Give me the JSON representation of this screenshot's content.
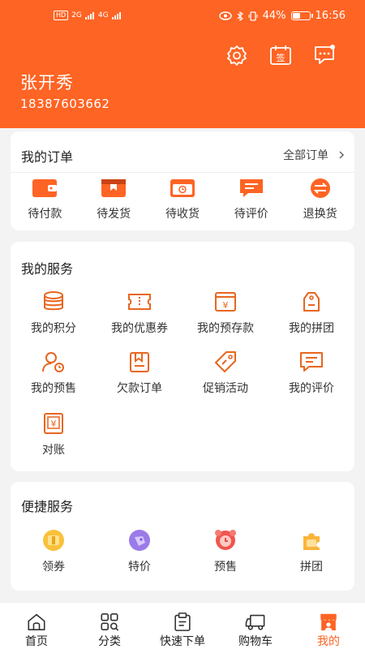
{
  "status_bar": {
    "left_indicators": [
      "HD",
      "2G",
      "4G"
    ],
    "battery_percent": "44%",
    "time": "16:56"
  },
  "header": {
    "icons": [
      "settings-icon",
      "sign-in-icon",
      "message-icon"
    ],
    "user_name": "张开秀",
    "phone": "18387603662"
  },
  "orders": {
    "title": "我的订单",
    "all_label": "全部订单",
    "items": [
      {
        "label": "待付款",
        "icon": "wallet-icon"
      },
      {
        "label": "待发货",
        "icon": "box-icon"
      },
      {
        "label": "待收货",
        "icon": "delivery-icon"
      },
      {
        "label": "待评价",
        "icon": "comment-icon"
      },
      {
        "label": "退换货",
        "icon": "exchange-icon"
      }
    ]
  },
  "services": {
    "title": "我的服务",
    "items": [
      {
        "label": "我的积分",
        "icon": "points-icon"
      },
      {
        "label": "我的优惠券",
        "icon": "coupon-icon"
      },
      {
        "label": "我的预存款",
        "icon": "deposit-icon"
      },
      {
        "label": "我的拼团",
        "icon": "group-buy-icon"
      },
      {
        "label": "我的预售",
        "icon": "presale-icon"
      },
      {
        "label": "欠款订单",
        "icon": "debt-order-icon"
      },
      {
        "label": "促销活动",
        "icon": "promotion-icon"
      },
      {
        "label": "我的评价",
        "icon": "review-icon"
      },
      {
        "label": "对账",
        "icon": "reconcile-icon"
      }
    ]
  },
  "quick": {
    "title": "便捷服务",
    "items": [
      {
        "label": "领券",
        "icon": "get-coupon-icon"
      },
      {
        "label": "特价",
        "icon": "special-price-icon"
      },
      {
        "label": "预售",
        "icon": "alarm-icon"
      },
      {
        "label": "拼团",
        "icon": "puzzle-icon"
      }
    ]
  },
  "tabbar": {
    "items": [
      {
        "label": "首页",
        "icon": "home-icon"
      },
      {
        "label": "分类",
        "icon": "category-icon"
      },
      {
        "label": "快速下单",
        "icon": "clipboard-icon"
      },
      {
        "label": "购物车",
        "icon": "truck-icon"
      },
      {
        "label": "我的",
        "icon": "profile-store-icon"
      }
    ],
    "active_index": 4
  },
  "colors": {
    "brand": "#fe6424",
    "background": "#f3f3f3",
    "card": "#ffffff",
    "text": "#222222"
  }
}
